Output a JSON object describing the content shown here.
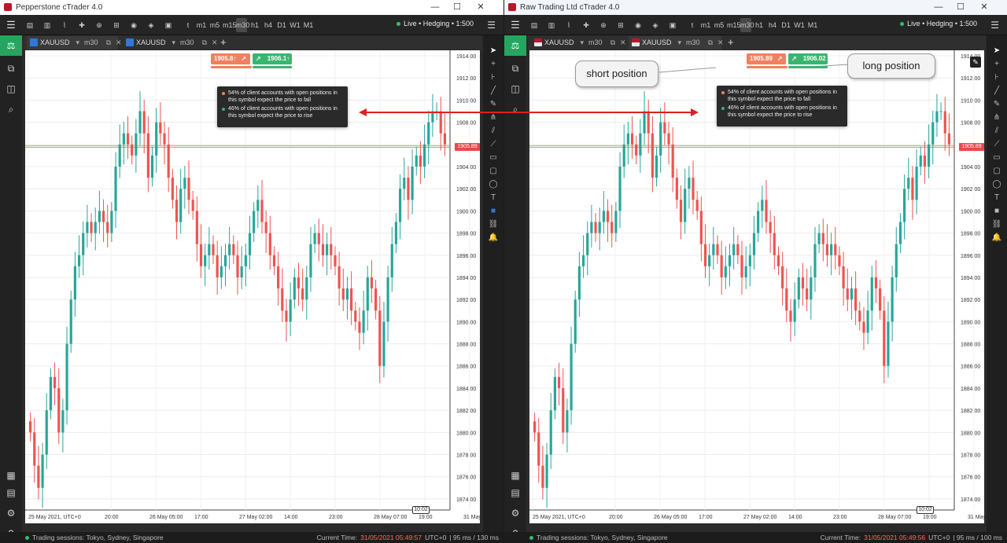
{
  "windows": [
    {
      "title": "Pepperstone cTrader 4.0",
      "brand_color": "#c0142b",
      "account_status": "Live • Hedging • 1:500",
      "timeframes": [
        "t",
        "m1",
        "m5",
        "m15",
        "m30",
        "h1",
        "h4",
        "D1",
        "W1",
        "M1"
      ],
      "selected_timeframe": "m30",
      "tabs": [
        {
          "symbol": "XAUUSD",
          "timeframe": "m30",
          "active": true
        },
        {
          "symbol": "XAUUSD",
          "timeframe": "m30",
          "active": false
        }
      ],
      "sentiment": {
        "sell_price": "1905.8↑",
        "buy_price": "1906.1↑"
      },
      "tooltip": {
        "sell_text": "54% of client accounts with open positions in this symbol expect the price to fall",
        "buy_text": "46% of client accounts with open positions in this symbol expect the price to rise"
      },
      "current_price_label": "1905.89",
      "time_marker": "10:02",
      "status": {
        "sessions": "Trading sessions: Tokyo, Sydney, Singapore",
        "current_time_label": "Current Time:",
        "current_time": "31/05/2021 05:49:57",
        "timezone": "UTC+0",
        "latency": "| 95 ms / 130 ms"
      }
    },
    {
      "title": "Raw Trading Ltd cTrader 4.0",
      "brand_color": "#c0142b",
      "account_status": "Live • Hedging • 1:500",
      "timeframes": [
        "t",
        "m1",
        "m5",
        "m15",
        "m30",
        "h1",
        "h4",
        "D1",
        "W1",
        "M1"
      ],
      "selected_timeframe": "m30",
      "tabs": [
        {
          "symbol": "XAUUSD",
          "timeframe": "m30",
          "active": false
        },
        {
          "symbol": "XAUUSD",
          "timeframe": "m30",
          "active": true
        }
      ],
      "sentiment": {
        "sell_price": "1905.89",
        "buy_price": "1906.02"
      },
      "tooltip": {
        "sell_text": "54% of client accounts with open positions in this symbol expect the price to fall",
        "buy_text": "46% of client accounts with open positions in this symbol expect the price to rise"
      },
      "current_price_label": "1905.89",
      "time_marker": "10:02",
      "status": {
        "sessions": "Trading sessions: Tokyo, Sydney, Singapore",
        "current_time_label": "Current Time:",
        "current_time": "31/05/2021 05:49:56",
        "timezone": "UTC+0",
        "latency": "| 95 ms / 100 ms"
      }
    }
  ],
  "annotations": {
    "short_label": "short position",
    "long_label": "long position",
    "arrow_color": "#e02020"
  },
  "chart_data": [
    {
      "type": "candlestick",
      "symbol": "XAUUSD",
      "timeframe": "m30",
      "y_ticks": [
        "1914.00",
        "1912.00",
        "1910.00",
        "1908.00",
        "1906.00",
        "1904.00",
        "1902.00",
        "1900.00",
        "1898.00",
        "1896.00",
        "1894.00",
        "1892.00",
        "1890.00",
        "1888.00",
        "1886.00",
        "1884.00",
        "1882.00",
        "1880.00",
        "1878.00",
        "1876.00",
        "1874.00"
      ],
      "x_ticks": [
        "25 May 2021, UTC+0",
        "20:00",
        "26 May 05:00",
        "17:00",
        "27 May 02:00",
        "14:00",
        "23:00",
        "28 May 07:00",
        "19:00",
        "31 May 04:00"
      ],
      "ylim": [
        1873,
        1914.5
      ],
      "closes": [
        1880,
        1877,
        1875,
        1878,
        1882,
        1885,
        1884,
        1880,
        1882,
        1888,
        1892,
        1895,
        1896,
        1898,
        1899,
        1898,
        1899,
        1900,
        1899,
        1898,
        1900,
        1904,
        1906,
        1907,
        1906,
        1905,
        1907,
        1909,
        1907,
        1903,
        1905,
        1908,
        1907,
        1906,
        1903,
        1901,
        1899,
        1902,
        1903,
        1901,
        1900,
        1897,
        1895,
        1896,
        1897,
        1896,
        1894,
        1895,
        1896,
        1897,
        1896,
        1894,
        1895,
        1896,
        1898,
        1900,
        1901,
        1899,
        1898,
        1896,
        1895,
        1893,
        1891,
        1890,
        1892,
        1894,
        1893,
        1892,
        1894,
        1897,
        1898,
        1897,
        1896,
        1897,
        1896,
        1895,
        1893,
        1892,
        1893,
        1891,
        1890,
        1889,
        1891,
        1894,
        1893,
        1891,
        1886,
        1890,
        1894,
        1897,
        1899,
        1902,
        1903,
        1901,
        1904,
        1905,
        1904,
        1906,
        1908,
        1909,
        1909,
        1907,
        1906
      ],
      "current_price": 1905.89,
      "grid": true
    }
  ]
}
